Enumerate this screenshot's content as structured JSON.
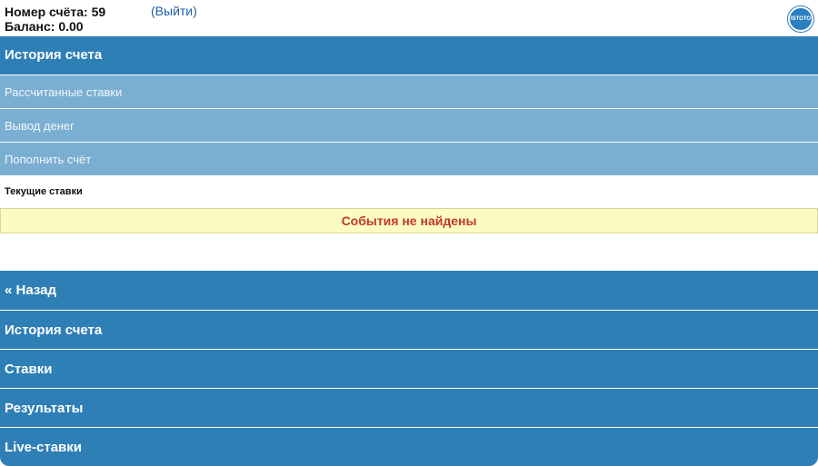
{
  "header": {
    "account_number": "Номер счёта: 59",
    "balance": "Баланс: 0.00",
    "logout": "(Выйти)",
    "logo_text": "ISTOTO"
  },
  "history": {
    "title": "История счета",
    "items": [
      {
        "label": "Рассчитанные ставки"
      },
      {
        "label": "Вывод денег"
      },
      {
        "label": "Пополнить счёт"
      }
    ]
  },
  "current_bets": {
    "title": "Текущие ставки",
    "empty_message": "События не найдены"
  },
  "bottom_nav": {
    "items": [
      {
        "label": "« Назад"
      },
      {
        "label": "История счета"
      },
      {
        "label": "Ставки"
      },
      {
        "label": "Результаты"
      },
      {
        "label": "Live-ставки"
      }
    ]
  },
  "colors": {
    "primary": "#2f7fb7",
    "secondary": "#7aaed3",
    "notice_bg": "#fdfbc4",
    "notice_text": "#c0392b",
    "link": "#1f5fa8"
  },
  "icons": {
    "logo": "site-logo-icon"
  }
}
